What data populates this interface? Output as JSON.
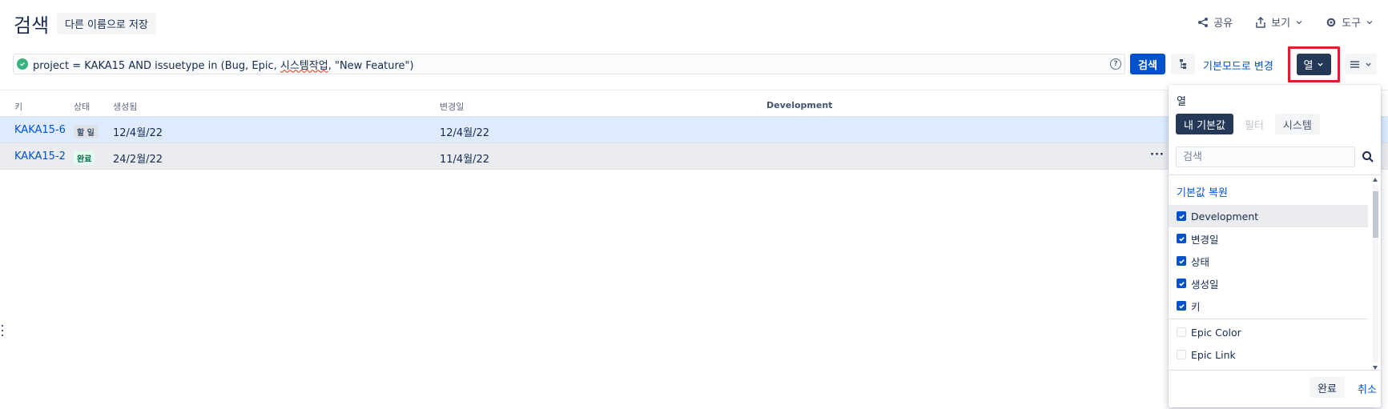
{
  "header": {
    "title": "검색",
    "save_as_label": "다른 이름으로 저장",
    "share_label": "공유",
    "view_label": "보기",
    "tools_label": "도구"
  },
  "query": {
    "prefix": "project = KAKA15 AND issuetype in (Bug, Epic, ",
    "misspelled": "시스템작업",
    "suffix": ", \"New Feature\")",
    "help_icon": "?"
  },
  "toolbar": {
    "search_label": "검색",
    "basic_mode_label": "기본모드로 변경",
    "columns_label": "열"
  },
  "table": {
    "headers": [
      "키",
      "상태",
      "생성됨",
      "변경일",
      "Development"
    ],
    "rows": [
      {
        "key": "KAKA15-6",
        "status": "할 일",
        "created": "12/4월/22",
        "updated": "12/4월/22"
      },
      {
        "key": "KAKA15-2",
        "status": "완료",
        "created": "24/2월/22",
        "updated": "11/4월/22",
        "more": "···"
      }
    ]
  },
  "columns_panel": {
    "title": "열",
    "tabs": [
      "내 기본값",
      "필터",
      "시스템"
    ],
    "search_placeholder": "검색",
    "restore_label": "기본값 복원",
    "checked_options": [
      "Development",
      "변경일",
      "상태",
      "생성일",
      "키"
    ],
    "unchecked_options": [
      "Epic Color",
      "Epic Link"
    ],
    "done_label": "완료",
    "cancel_label": "취소"
  },
  "colors": {
    "primary": "#0052cc",
    "dark_button": "#253858",
    "highlight_outline": "#e01e2b",
    "selected_row": "#deebff",
    "ok_green": "#36b37e"
  }
}
